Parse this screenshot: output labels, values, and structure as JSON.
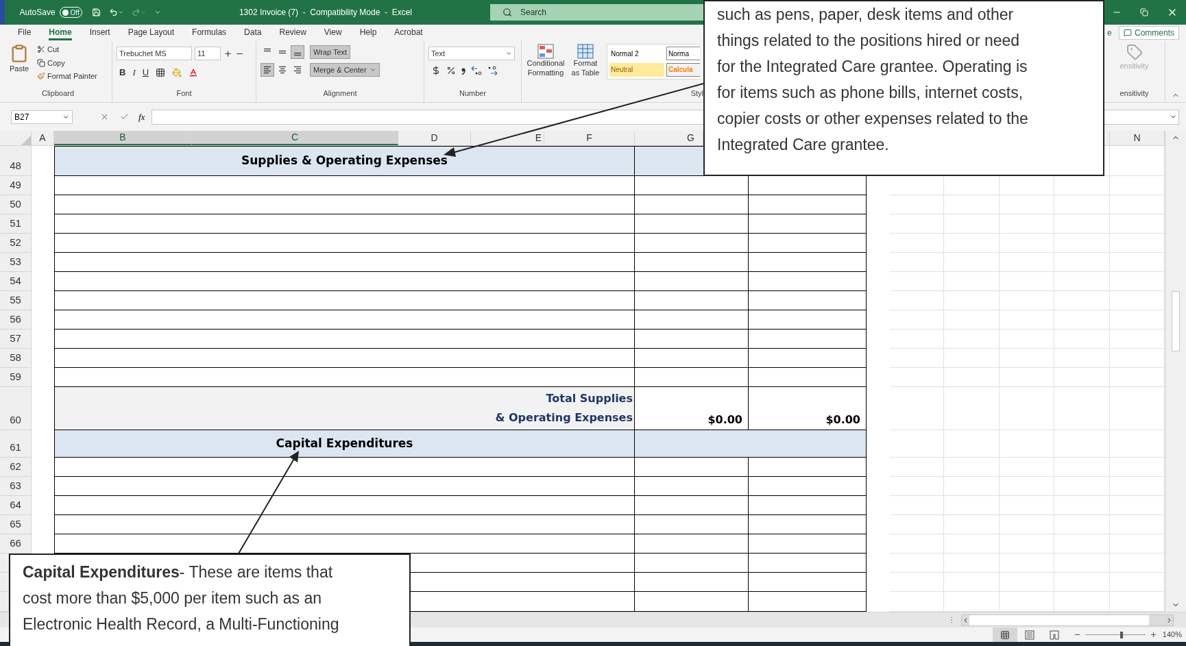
{
  "title_bar": {
    "autosave": "AutoSave",
    "autosave_toggle": {
      "label": "Off",
      "on": false
    },
    "title": "1302 Invoice (7)  -  Compatibility Mode  -  Excel",
    "search": {
      "placeholder": "Search"
    }
  },
  "tabs": [
    {
      "label": "File",
      "selected": false
    },
    {
      "label": "Home",
      "selected": true
    },
    {
      "label": "Insert",
      "selected": false
    },
    {
      "label": "Page Layout",
      "selected": false
    },
    {
      "label": "Formulas",
      "selected": false
    },
    {
      "label": "Data",
      "selected": false
    },
    {
      "label": "Review",
      "selected": false
    },
    {
      "label": "View",
      "selected": false
    },
    {
      "label": "Help",
      "selected": false
    },
    {
      "label": "Acrobat",
      "selected": false
    }
  ],
  "share_cut": "e",
  "comments": "Comments",
  "ribbon": {
    "clipboard": {
      "paste": "Paste",
      "cut": "Cut",
      "copy": "Copy",
      "format_painter": "Format Painter",
      "label": "Clipboard"
    },
    "font": {
      "name": "Trebuchet MS",
      "size": "11",
      "bold": "B",
      "italic": "I",
      "underline": "U",
      "label": "Font"
    },
    "alignment": {
      "wrap_text": {
        "label": "Wrap Text",
        "pressed": true
      },
      "merge": {
        "label": "Merge & Center",
        "pressed": true
      },
      "horizontal": [
        {
          "kind": "left",
          "pressed": true
        },
        {
          "kind": "center",
          "pressed": false
        },
        {
          "kind": "right",
          "pressed": false
        }
      ],
      "vertical": [
        {
          "kind": "top",
          "pressed": false
        },
        {
          "kind": "middle",
          "pressed": false
        },
        {
          "kind": "bottom",
          "pressed": true
        }
      ],
      "label": "Alignment"
    },
    "number": {
      "format": "Text",
      "label": "Number"
    },
    "styles": {
      "conditional": "Conditional Formatting",
      "format_table": "Format as Table",
      "cells": [
        {
          "label": "Normal 2",
          "kind": "normal"
        },
        {
          "label": "Norma",
          "kind": "outlined"
        },
        {
          "label": "Neutral",
          "kind": "neutral"
        },
        {
          "label": "Calcula",
          "kind": "calculation"
        }
      ],
      "label": "Styl"
    },
    "sensitivity": {
      "button": "ensitivity",
      "label": "ensitivity",
      "disabled": true
    }
  },
  "formula_bar": {
    "name_box": "B27",
    "function_button": "fx"
  },
  "columns": [
    {
      "label": "A",
      "selected": false
    },
    {
      "label": "B",
      "selected": true
    },
    {
      "label": "C",
      "selected": true
    },
    {
      "label": "D",
      "selected": false
    },
    {
      "label": "E",
      "selected": false
    },
    {
      "label": "F",
      "selected": false
    },
    {
      "label": "G",
      "selected": false
    },
    {
      "label": "N",
      "selected": false
    }
  ],
  "rows": [
    {
      "number": "48",
      "kind": "header",
      "title": "Supplies & Operating Expenses"
    },
    {
      "number": "49",
      "kind": "blank"
    },
    {
      "number": "50",
      "kind": "blank"
    },
    {
      "number": "51",
      "kind": "blank"
    },
    {
      "number": "52",
      "kind": "blank"
    },
    {
      "number": "53",
      "kind": "blank"
    },
    {
      "number": "54",
      "kind": "blank"
    },
    {
      "number": "55",
      "kind": "blank"
    },
    {
      "number": "56",
      "kind": "blank"
    },
    {
      "number": "57",
      "kind": "blank"
    },
    {
      "number": "58",
      "kind": "blank"
    },
    {
      "number": "59",
      "kind": "blank"
    },
    {
      "number": "60",
      "kind": "total",
      "label_lines": [
        "Total Supplies",
        "& Operating Expenses"
      ],
      "values": [
        "$0.00",
        "$0.00"
      ]
    },
    {
      "number": "61",
      "kind": "section",
      "title": "Capital Expenditures"
    },
    {
      "number": "62",
      "kind": "blank"
    },
    {
      "number": "63",
      "kind": "blank"
    },
    {
      "number": "64",
      "kind": "blank"
    },
    {
      "number": "65",
      "kind": "blank"
    },
    {
      "number": "66",
      "kind": "blank"
    }
  ],
  "callouts": [
    {
      "kind": "top",
      "lines": [
        "such as pens, paper, desk items and other",
        "things related to the positions hired or need",
        "for the Integrated Care grantee. Operating is",
        "for items such as phone bills, internet costs,",
        "copier costs or other expenses related to the",
        "Integrated Care grantee."
      ]
    },
    {
      "kind": "bottom",
      "lines": [
        "**Capital Expenditures**- These are items that",
        "cost more than $5,000 per item such as an",
        "Electronic Health Record, a Multi-Functioning"
      ]
    }
  ],
  "status_bar": {
    "views": [
      {
        "kind": "normal",
        "selected": true
      },
      {
        "kind": "page_layout",
        "selected": false
      },
      {
        "kind": "page_break",
        "selected": false
      }
    ],
    "zoom": {
      "level": 0.6,
      "reading": "140%"
    }
  }
}
